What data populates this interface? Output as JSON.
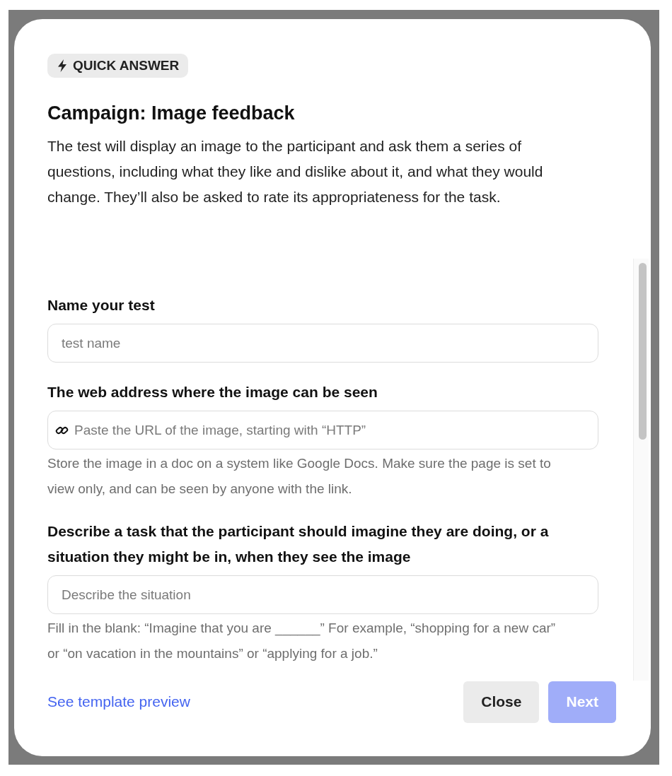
{
  "badge": {
    "label": "QUICK ANSWER"
  },
  "title": "Campaign: Image feedback",
  "description": "The test will display an image to the participant and ask them a series of questions, including what they like and dislike about it, and what they would change. They’ll also be asked to rate its appropriateness for the task.",
  "fields": [
    {
      "kind": "text",
      "label": "Name your test",
      "placeholder": "test name"
    },
    {
      "kind": "link",
      "label": "The web address where the image can be seen",
      "placeholder": "Paste the URL of the image, starting with “HTTP”",
      "help": "Store the image in a doc on a system like Google Docs. Make sure the page is set to view only, and can be seen by anyone with the link."
    },
    {
      "kind": "text",
      "label": "Describe a task that the participant should imagine they are doing, or a situation they might be in, when they see the image",
      "placeholder": "Describe the situation",
      "help": "Fill in the blank: “Imagine that you are ______” For example, “shopping for a new car” or “on vacation in the mountains” or “applying for a job.”"
    }
  ],
  "footer": {
    "link": "See template preview",
    "buttons": [
      {
        "kind": "secondary",
        "label": "Close",
        "disabled": false
      },
      {
        "kind": "primary",
        "label": "Next",
        "disabled": true
      }
    ]
  }
}
